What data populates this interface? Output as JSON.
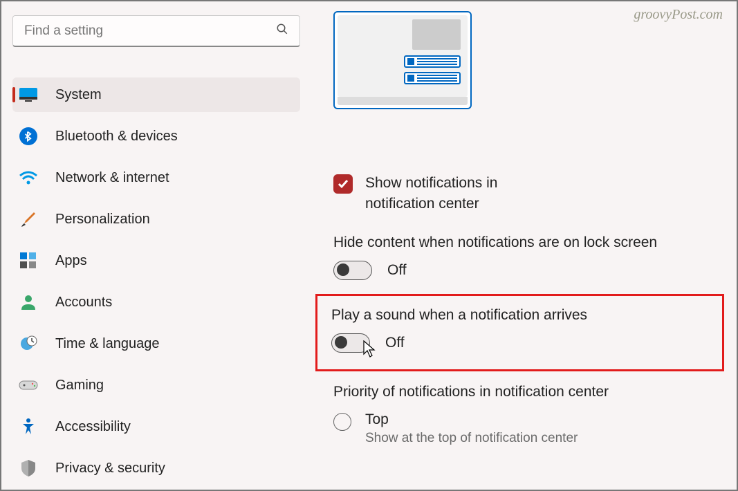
{
  "watermark": "groovyPost.com",
  "search": {
    "placeholder": "Find a setting"
  },
  "sidebar": {
    "items": [
      {
        "id": "system",
        "label": "System",
        "active": true
      },
      {
        "id": "bluetooth",
        "label": "Bluetooth & devices"
      },
      {
        "id": "network",
        "label": "Network & internet"
      },
      {
        "id": "personalization",
        "label": "Personalization"
      },
      {
        "id": "apps",
        "label": "Apps"
      },
      {
        "id": "accounts",
        "label": "Accounts"
      },
      {
        "id": "time",
        "label": "Time & language"
      },
      {
        "id": "gaming",
        "label": "Gaming"
      },
      {
        "id": "accessibility",
        "label": "Accessibility"
      },
      {
        "id": "privacy",
        "label": "Privacy & security"
      }
    ]
  },
  "main": {
    "show_notif_label": "Show notifications in notification center",
    "hide_content": {
      "title": "Hide content when notifications are on lock screen",
      "state": "Off"
    },
    "play_sound": {
      "title": "Play a sound when a notification arrives",
      "state": "Off"
    },
    "priority": {
      "title": "Priority of notifications in notification center",
      "option_label": "Top",
      "option_desc": "Show at the top of notification center"
    }
  }
}
